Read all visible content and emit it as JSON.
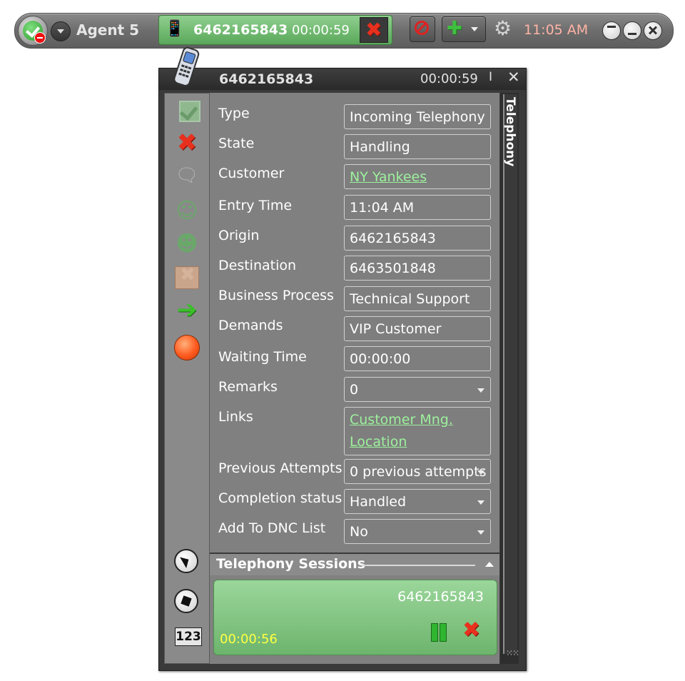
{
  "agentbar": {
    "agent_name": "Agent 5",
    "call_number": "6462165843",
    "call_duration": "00:00:59",
    "clock": "11:05 AM",
    "icons": [
      "status-available-icon",
      "dropdown-icon",
      "phone-icon",
      "hangup-icon",
      "mute-icon",
      "add-icon",
      "gear-icon",
      "restore-icon",
      "minimize-icon",
      "close-icon"
    ]
  },
  "panel": {
    "number": "6462165843",
    "duration": "00:00:59",
    "side_tab": "Telephony",
    "fields": [
      {
        "label": "Type",
        "value": "Incoming Telephony"
      },
      {
        "label": "State",
        "value": "Handling"
      },
      {
        "label": "Customer",
        "value": "NY Yankees"
      },
      {
        "label": "Entry Time",
        "value": "11:04 AM"
      },
      {
        "label": "Origin",
        "value": "6462165843"
      },
      {
        "label": "Destination",
        "value": "6463501848"
      },
      {
        "label": "Business Process",
        "value": "Technical Support"
      },
      {
        "label": "Demands",
        "value": "VIP Customer"
      },
      {
        "label": "Waiting Time",
        "value": "00:00:00"
      },
      {
        "label": "Remarks",
        "value": "0"
      },
      {
        "label": "Links",
        "value": "Customer Mng. Location"
      },
      {
        "label": "Previous Attempts",
        "value": "0 previous attempts"
      },
      {
        "label": "Completion status",
        "value": "Handled"
      },
      {
        "label": "Add To DNC List",
        "value": "No"
      }
    ],
    "keypad_label": "123"
  },
  "sessions": {
    "title": "Telephony Sessions",
    "items": [
      {
        "number": "6462165843",
        "duration": "00:00:56"
      }
    ]
  },
  "colors": {
    "call_green": "#6db46d",
    "hangup_red": "#e8301e",
    "clock_pink": "#ffb3a6",
    "link_green": "#9df09d",
    "session_timer_yellow": "#ffff44"
  }
}
